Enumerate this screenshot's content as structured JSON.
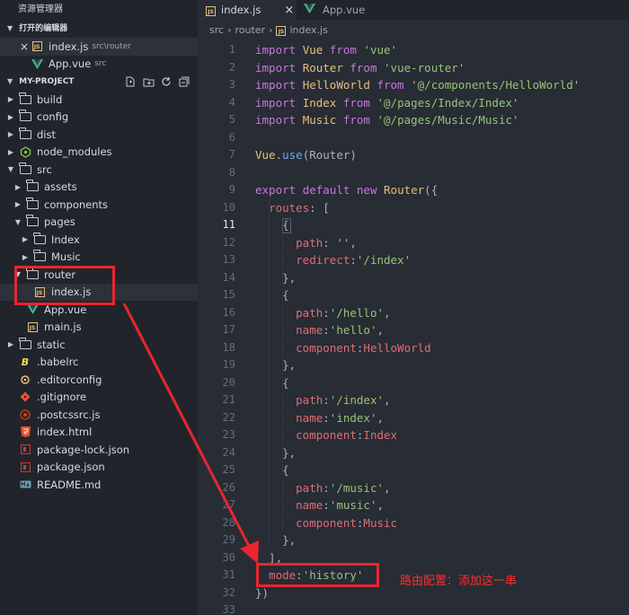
{
  "sidebar": {
    "title": "资源管理器",
    "open_editors_label": "打开的编辑器",
    "open_editors": [
      {
        "name": "index.js",
        "path": "src\\router",
        "icon": "js-file-icon"
      },
      {
        "name": "App.vue",
        "path": "src",
        "icon": "vue-file-icon"
      }
    ],
    "project_label": "MY-PROJECT",
    "tree": [
      {
        "label": "build",
        "type": "folder",
        "depth": 1,
        "open": false
      },
      {
        "label": "config",
        "type": "folder",
        "depth": 1,
        "open": false
      },
      {
        "label": "dist",
        "type": "folder",
        "depth": 1,
        "open": false
      },
      {
        "label": "node_modules",
        "type": "folder-node",
        "depth": 1,
        "open": false
      },
      {
        "label": "src",
        "type": "folder",
        "depth": 1,
        "open": true
      },
      {
        "label": "assets",
        "type": "folder",
        "depth": 2,
        "open": false
      },
      {
        "label": "components",
        "type": "folder",
        "depth": 2,
        "open": false
      },
      {
        "label": "pages",
        "type": "folder",
        "depth": 2,
        "open": true
      },
      {
        "label": "Index",
        "type": "folder",
        "depth": 3,
        "open": false
      },
      {
        "label": "Music",
        "type": "folder",
        "depth": 3,
        "open": false
      },
      {
        "label": "router",
        "type": "folder",
        "depth": 2,
        "open": true
      },
      {
        "label": "index.js",
        "type": "js",
        "depth": 3,
        "selected": true
      },
      {
        "label": "App.vue",
        "type": "vue",
        "depth": 2
      },
      {
        "label": "main.js",
        "type": "js",
        "depth": 2
      },
      {
        "label": "static",
        "type": "folder",
        "depth": 1,
        "open": false
      },
      {
        "label": ".babelrc",
        "type": "babel",
        "depth": 1
      },
      {
        "label": ".editorconfig",
        "type": "config",
        "depth": 1
      },
      {
        "label": ".gitignore",
        "type": "git",
        "depth": 1
      },
      {
        "label": ".postcssrc.js",
        "type": "postcss",
        "depth": 1
      },
      {
        "label": "index.html",
        "type": "html",
        "depth": 1
      },
      {
        "label": "package-lock.json",
        "type": "npm",
        "depth": 1
      },
      {
        "label": "package.json",
        "type": "npm",
        "depth": 1
      },
      {
        "label": "README.md",
        "type": "md",
        "depth": 1
      }
    ]
  },
  "tabs": [
    {
      "label": "index.js",
      "active": true,
      "close": "×"
    },
    {
      "label": "App.vue",
      "active": false
    }
  ],
  "breadcrumb": [
    "src",
    "router",
    "index.js"
  ],
  "editor": {
    "current_line": 11,
    "lines": [
      [
        [
          "kw",
          "import"
        ],
        [
          "punc",
          " "
        ],
        [
          "cls",
          "Vue"
        ],
        [
          "punc",
          " "
        ],
        [
          "kw",
          "from"
        ],
        [
          "punc",
          " "
        ],
        [
          "str",
          "'vue'"
        ]
      ],
      [
        [
          "kw",
          "import"
        ],
        [
          "punc",
          " "
        ],
        [
          "cls",
          "Router"
        ],
        [
          "punc",
          " "
        ],
        [
          "kw",
          "from"
        ],
        [
          "punc",
          " "
        ],
        [
          "str",
          "'vue-router'"
        ]
      ],
      [
        [
          "kw",
          "import"
        ],
        [
          "punc",
          " "
        ],
        [
          "cls",
          "HelloWorld"
        ],
        [
          "punc",
          " "
        ],
        [
          "kw",
          "from"
        ],
        [
          "punc",
          " "
        ],
        [
          "str",
          "'@/components/HelloWorld'"
        ]
      ],
      [
        [
          "kw",
          "import"
        ],
        [
          "punc",
          " "
        ],
        [
          "cls",
          "Index"
        ],
        [
          "punc",
          " "
        ],
        [
          "kw",
          "from"
        ],
        [
          "punc",
          " "
        ],
        [
          "str",
          "'@/pages/Index/Index'"
        ]
      ],
      [
        [
          "kw",
          "import"
        ],
        [
          "punc",
          " "
        ],
        [
          "cls",
          "Music"
        ],
        [
          "punc",
          " "
        ],
        [
          "kw",
          "from"
        ],
        [
          "punc",
          " "
        ],
        [
          "str",
          "'@/pages/Music/Music'"
        ]
      ],
      [],
      [
        [
          "cls",
          "Vue"
        ],
        [
          "punc",
          "."
        ],
        [
          "fn",
          "use"
        ],
        [
          "punc",
          "(Router)"
        ]
      ],
      [],
      [
        [
          "kw",
          "export"
        ],
        [
          "punc",
          " "
        ],
        [
          "kw",
          "default"
        ],
        [
          "punc",
          " "
        ],
        [
          "kw",
          "new"
        ],
        [
          "punc",
          " "
        ],
        [
          "cls",
          "Router"
        ],
        [
          "punc",
          "({"
        ]
      ],
      [
        [
          "punc",
          "  "
        ],
        [
          "prop",
          "routes"
        ],
        [
          "punc",
          ": ["
        ]
      ],
      [
        [
          "punc",
          "    {"
        ]
      ],
      [
        [
          "punc",
          "      "
        ],
        [
          "prop",
          "path"
        ],
        [
          "punc",
          ": "
        ],
        [
          "str",
          "''"
        ],
        [
          "punc",
          ","
        ]
      ],
      [
        [
          "punc",
          "      "
        ],
        [
          "prop",
          "redirect"
        ],
        [
          "punc",
          ":"
        ],
        [
          "str",
          "'/index'"
        ]
      ],
      [
        [
          "punc",
          "    },"
        ]
      ],
      [
        [
          "punc",
          "    {"
        ]
      ],
      [
        [
          "punc",
          "      "
        ],
        [
          "prop",
          "path"
        ],
        [
          "punc",
          ":"
        ],
        [
          "str",
          "'/hello'"
        ],
        [
          "punc",
          ","
        ]
      ],
      [
        [
          "punc",
          "      "
        ],
        [
          "prop",
          "name"
        ],
        [
          "punc",
          ":"
        ],
        [
          "str",
          "'hello'"
        ],
        [
          "punc",
          ","
        ]
      ],
      [
        [
          "punc",
          "      "
        ],
        [
          "prop",
          "component"
        ],
        [
          "punc",
          ":"
        ],
        [
          "prop",
          "HelloWorld"
        ]
      ],
      [
        [
          "punc",
          "    },"
        ]
      ],
      [
        [
          "punc",
          "    {"
        ]
      ],
      [
        [
          "punc",
          "      "
        ],
        [
          "prop",
          "path"
        ],
        [
          "punc",
          ":"
        ],
        [
          "str",
          "'/index'"
        ],
        [
          "punc",
          ","
        ]
      ],
      [
        [
          "punc",
          "      "
        ],
        [
          "prop",
          "name"
        ],
        [
          "punc",
          ":"
        ],
        [
          "str",
          "'index'"
        ],
        [
          "punc",
          ","
        ]
      ],
      [
        [
          "punc",
          "      "
        ],
        [
          "prop",
          "component"
        ],
        [
          "punc",
          ":"
        ],
        [
          "prop",
          "Index"
        ]
      ],
      [
        [
          "punc",
          "    },"
        ]
      ],
      [
        [
          "punc",
          "    {"
        ]
      ],
      [
        [
          "punc",
          "      "
        ],
        [
          "prop",
          "path"
        ],
        [
          "punc",
          ":"
        ],
        [
          "str",
          "'/music'"
        ],
        [
          "punc",
          ","
        ]
      ],
      [
        [
          "punc",
          "      "
        ],
        [
          "prop",
          "name"
        ],
        [
          "punc",
          ":"
        ],
        [
          "str",
          "'music'"
        ],
        [
          "punc",
          ","
        ]
      ],
      [
        [
          "punc",
          "      "
        ],
        [
          "prop",
          "component"
        ],
        [
          "punc",
          ":"
        ],
        [
          "prop",
          "Music"
        ]
      ],
      [
        [
          "punc",
          "    },"
        ]
      ],
      [
        [
          "punc",
          "  ],"
        ]
      ],
      [
        [
          "punc",
          "  "
        ],
        [
          "prop",
          "mode"
        ],
        [
          "punc",
          ":"
        ],
        [
          "str",
          "'history'"
        ]
      ],
      [
        [
          "punc",
          "})"
        ]
      ],
      []
    ]
  },
  "annotation": "路由配置：添加这一串",
  "colors": {
    "highlight": "#e8262e",
    "keyword": "#c678dd",
    "string": "#98c379",
    "class": "#e5c07b",
    "property": "#e06c75"
  }
}
